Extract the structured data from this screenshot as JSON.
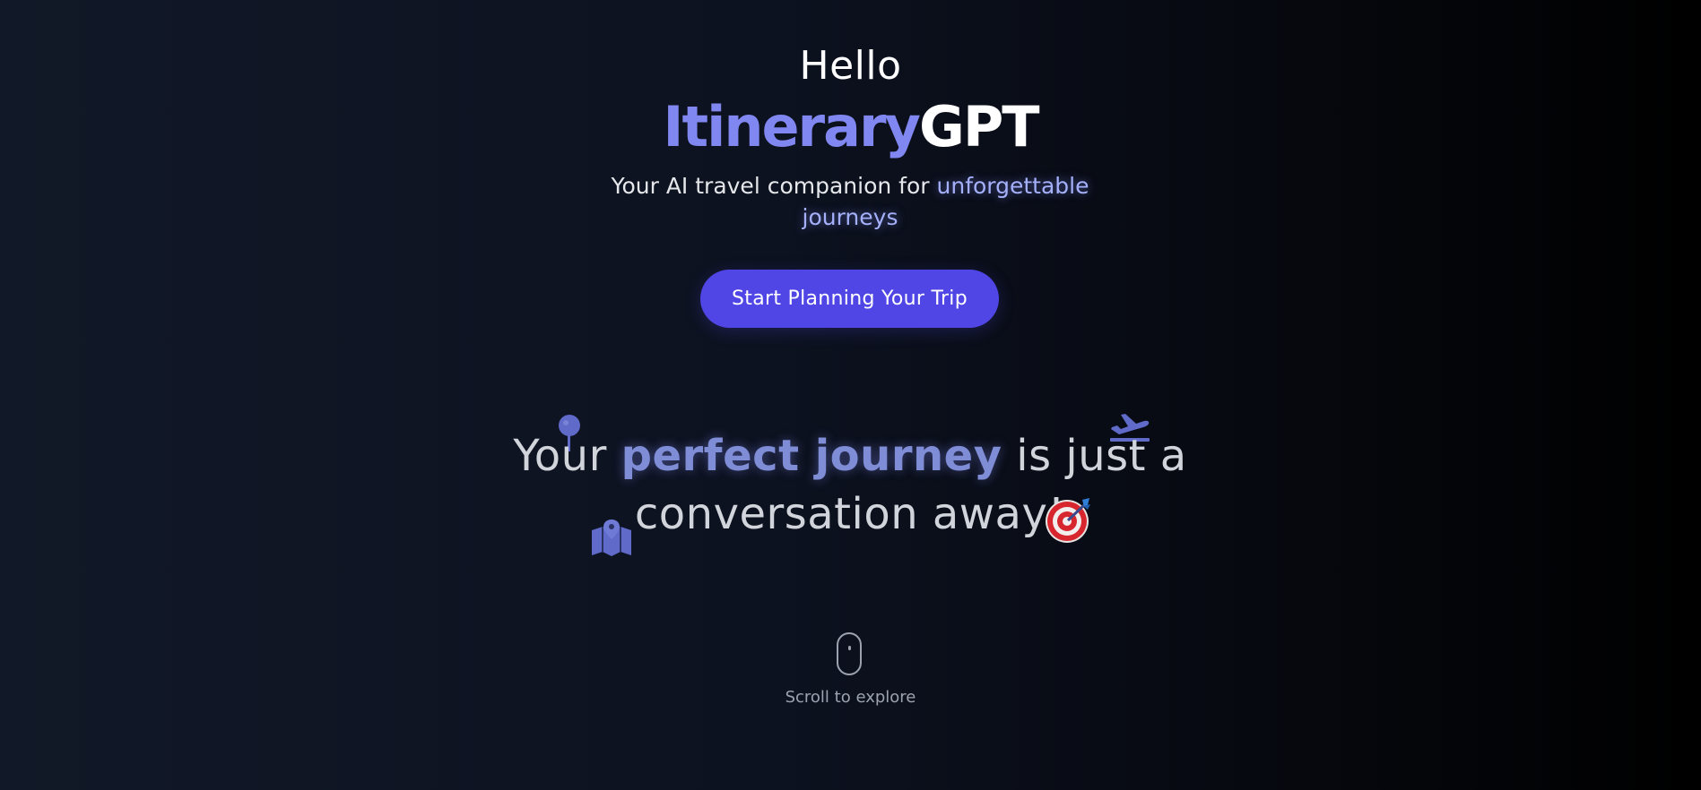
{
  "hero": {
    "greeting": "Hello",
    "brand_accent": "Itinerary",
    "brand_plain": "GPT",
    "tagline_plain": "Your AI travel companion for ",
    "tagline_highlight": "unforgettable journeys",
    "cta_label": "Start Planning Your Trip"
  },
  "headline": {
    "part1": "Your ",
    "highlight": "perfect journey",
    "part2": " is just a conversation away! "
  },
  "scroll": {
    "label": "Scroll to explore"
  },
  "icons": [
    "map-pin-icon",
    "airplane-takeoff-icon",
    "map-icon",
    "target-icon",
    "mouse-icon"
  ],
  "colors": {
    "accent": "#8187f0",
    "button": "#4f46e5",
    "highlight": "#a5b0fb",
    "muted": "#9ca3af"
  }
}
